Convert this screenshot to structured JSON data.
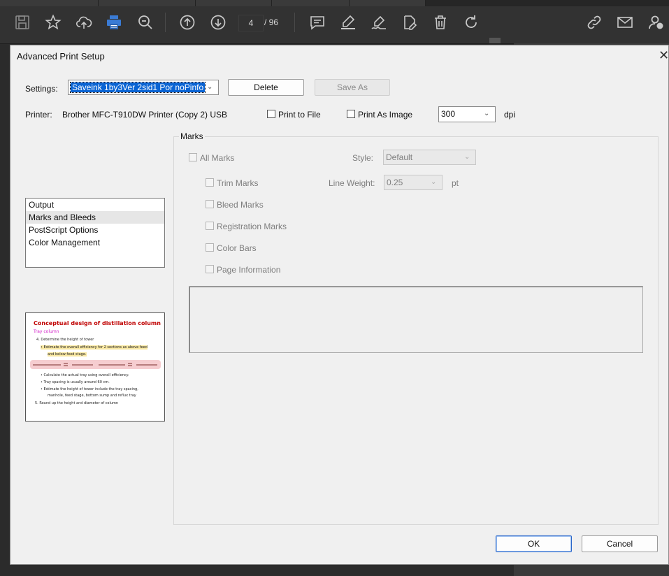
{
  "toolbar": {
    "icons": [
      "save-icon",
      "star-icon",
      "upload-icon",
      "print-icon",
      "zoom-out-icon",
      "page-up-icon",
      "page-down-icon",
      "comment-icon",
      "highlight-icon",
      "sign-icon",
      "edit-pdf-icon",
      "delete-icon",
      "rotate-icon",
      "link-icon",
      "mail-icon",
      "account-icon"
    ],
    "current_page": "4",
    "page_total": "/  96",
    "accent": "#3a7bd5"
  },
  "dialog": {
    "title": "Advanced Print Setup",
    "close_glyph": "✕",
    "settings_label": "Settings:",
    "settings_value": "Saveink 1by3Ver 2sid1 Por noPinfo",
    "delete_button": "Delete",
    "save_as_button": "Save As",
    "printer_label": "Printer:",
    "printer_name": "Brother MFC-T910DW Printer (Copy 2) USB",
    "print_to_file": "Print to File",
    "print_as_image": "Print As Image",
    "dpi_value": "300",
    "dpi_unit": "dpi",
    "categories": [
      "Output",
      "Marks and Bleeds",
      "PostScript Options",
      "Color Management"
    ],
    "selected_category": "Marks and Bleeds",
    "ok_button": "OK",
    "cancel_button": "Cancel"
  },
  "marks": {
    "group_title": "Marks",
    "all_marks": "All Marks",
    "style_label": "Style:",
    "style_value": "Default",
    "trim_marks": "Trim Marks",
    "line_weight_label": "Line Weight:",
    "line_weight_value": "0.25",
    "line_weight_unit": "pt",
    "bleed_marks": "Bleed Marks",
    "registration_marks": "Registration Marks",
    "color_bars": "Color Bars",
    "page_information": "Page Information"
  },
  "preview": {
    "title": "Conceptual design of distillation column",
    "subtitle": "Tray column",
    "step4": "4.     Determine the height of tower",
    "bullet1a": "•  Estimate the overall efficiency for 2 sections as above feed",
    "bullet1b": "and below feed stage.",
    "bullet2": "•  Calculate the actual tray using overall efficiency.",
    "bullet3": "•  Tray spacing is usually around 60 cm.",
    "bullet4a": "•  Estimate the height of tower include the tray spacing,",
    "bullet4b": "manhole, feed stage, bottom sump and reflux tray",
    "step5": "5.    Round up the height and diameter of column"
  }
}
